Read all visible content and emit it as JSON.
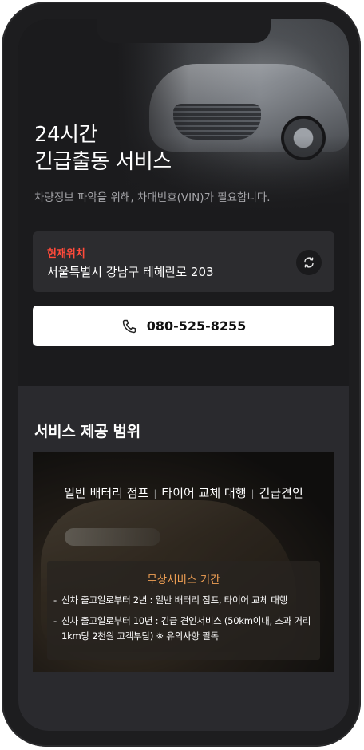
{
  "hero": {
    "title_line1": "24시간",
    "title_line2": "긴급출동 서비스",
    "subtitle": "차량정보 파악을 위해, 차대번호(VIN)가 필요합니다."
  },
  "location": {
    "label": "현재위치",
    "address": "서울특별시 강남구 테헤란로 203",
    "refresh_icon": "refresh-icon"
  },
  "call": {
    "phone_icon": "phone-icon",
    "number": "080-525-8255"
  },
  "services": {
    "title": "서비스 제공 범위",
    "tabs": [
      "일반 배터리 점프",
      "타이어 교체 대행",
      "긴급견인"
    ],
    "free_service": {
      "title": "무상서비스 기간",
      "items": [
        "신차 출고일로부터 2년 : 일반 배터리 점프, 타이어 교체 대행",
        "신차 출고일로부터 10년 : 긴급 견인서비스 (50km이내, 초과 거리 1km당 2천원 고객부담) ※ 유의사항 필독"
      ]
    }
  },
  "colors": {
    "accent_red": "#ff4a3a",
    "accent_orange": "#f0a054",
    "background": "#1c1c1e"
  }
}
